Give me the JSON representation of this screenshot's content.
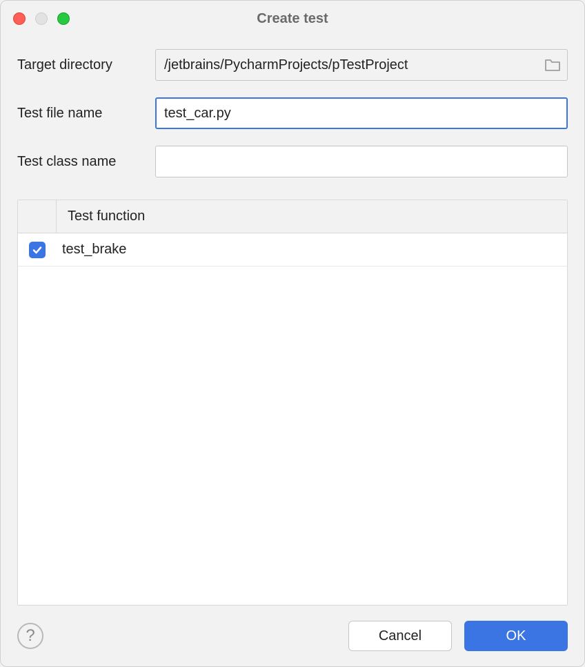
{
  "window": {
    "title": "Create test"
  },
  "form": {
    "target_directory": {
      "label": "Target directory",
      "value": "/jetbrains/PycharmProjects/pTestProject"
    },
    "test_file_name": {
      "label": "Test file name",
      "value": "test_car.py"
    },
    "test_class_name": {
      "label": "Test class name",
      "value": ""
    }
  },
  "table": {
    "header": "Test function",
    "rows": [
      {
        "checked": true,
        "name": "test_brake"
      }
    ]
  },
  "footer": {
    "help_label": "?",
    "cancel_label": "Cancel",
    "ok_label": "OK"
  }
}
